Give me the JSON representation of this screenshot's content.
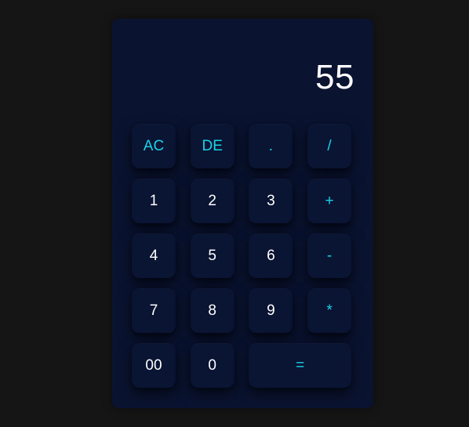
{
  "display": {
    "value": "55"
  },
  "colors": {
    "page_background": "#151515",
    "calculator_background": "#0a1330",
    "key_background": "#0a1433",
    "number_text": "#ffffff",
    "operator_text": "#19d3e8"
  },
  "keys": [
    {
      "label": "AC",
      "type": "op",
      "name": "all-clear-button"
    },
    {
      "label": "DE",
      "type": "op",
      "name": "delete-button"
    },
    {
      "label": ".",
      "type": "op",
      "name": "decimal-button"
    },
    {
      "label": "/",
      "type": "op",
      "name": "divide-button"
    },
    {
      "label": "1",
      "type": "num",
      "name": "digit-1-button"
    },
    {
      "label": "2",
      "type": "num",
      "name": "digit-2-button"
    },
    {
      "label": "3",
      "type": "num",
      "name": "digit-3-button"
    },
    {
      "label": "+",
      "type": "op",
      "name": "add-button"
    },
    {
      "label": "4",
      "type": "num",
      "name": "digit-4-button"
    },
    {
      "label": "5",
      "type": "num",
      "name": "digit-5-button"
    },
    {
      "label": "6",
      "type": "num",
      "name": "digit-6-button"
    },
    {
      "label": "-",
      "type": "op",
      "name": "subtract-button"
    },
    {
      "label": "7",
      "type": "num",
      "name": "digit-7-button"
    },
    {
      "label": "8",
      "type": "num",
      "name": "digit-8-button"
    },
    {
      "label": "9",
      "type": "num",
      "name": "digit-9-button"
    },
    {
      "label": "*",
      "type": "op",
      "name": "multiply-button"
    },
    {
      "label": "00",
      "type": "num",
      "name": "double-zero-button"
    },
    {
      "label": "0",
      "type": "num",
      "name": "digit-0-button"
    },
    {
      "label": "=",
      "type": "op",
      "name": "equals-button",
      "wide": true
    }
  ]
}
